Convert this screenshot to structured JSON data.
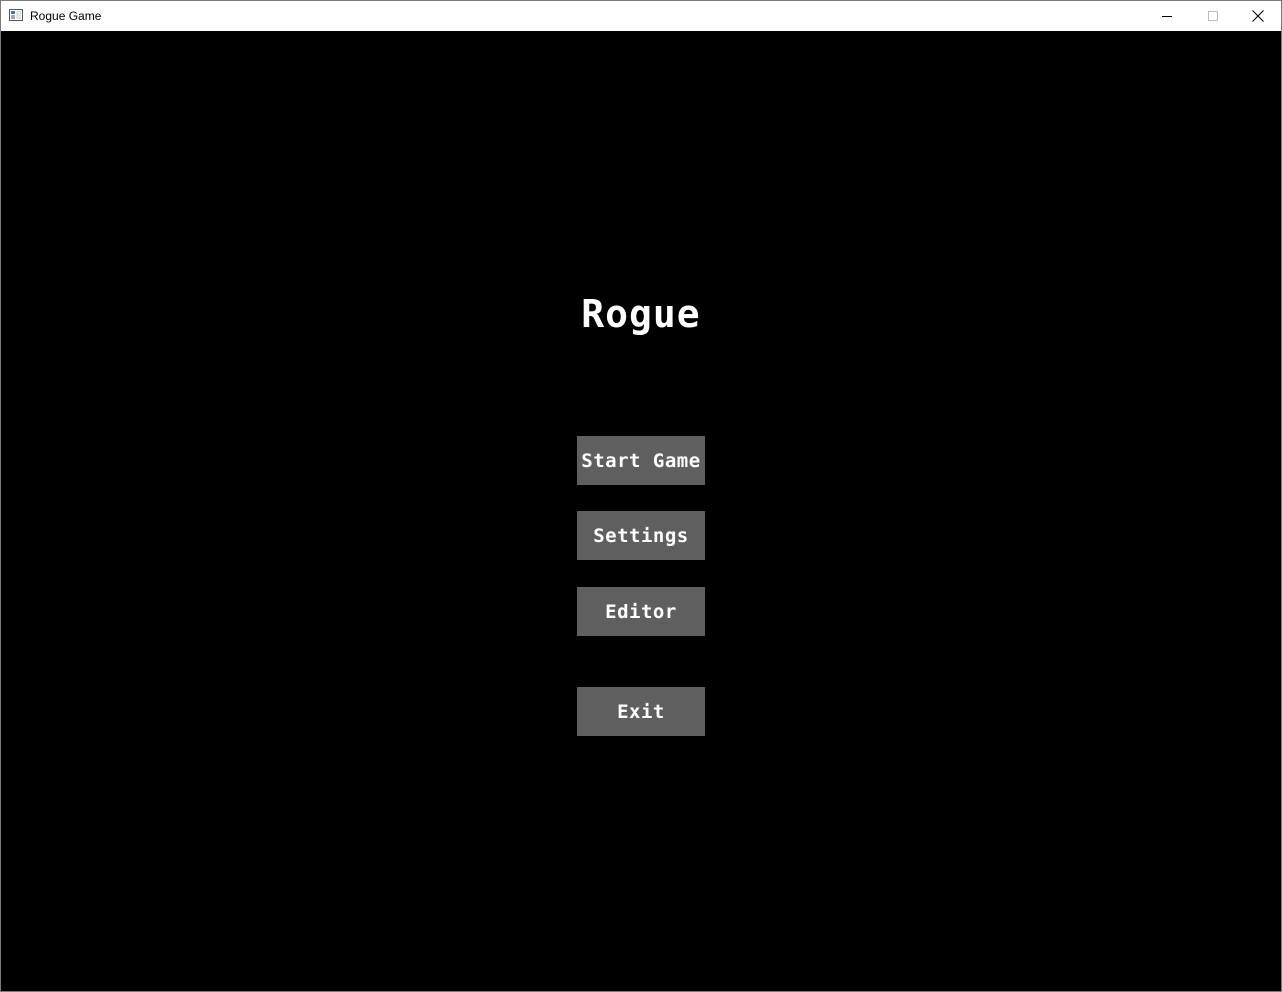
{
  "window": {
    "title": "Rogue Game",
    "controls": {
      "minimize_icon": "minimize-icon",
      "maximize_icon": "maximize-icon",
      "close_icon": "close-icon"
    }
  },
  "game": {
    "title": "Rogue",
    "menu": {
      "start_label": "Start Game",
      "settings_label": "Settings",
      "editor_label": "Editor",
      "exit_label": "Exit"
    }
  },
  "colors": {
    "background": "#000000",
    "button": "#5f5f5f",
    "text": "#ffffff"
  }
}
